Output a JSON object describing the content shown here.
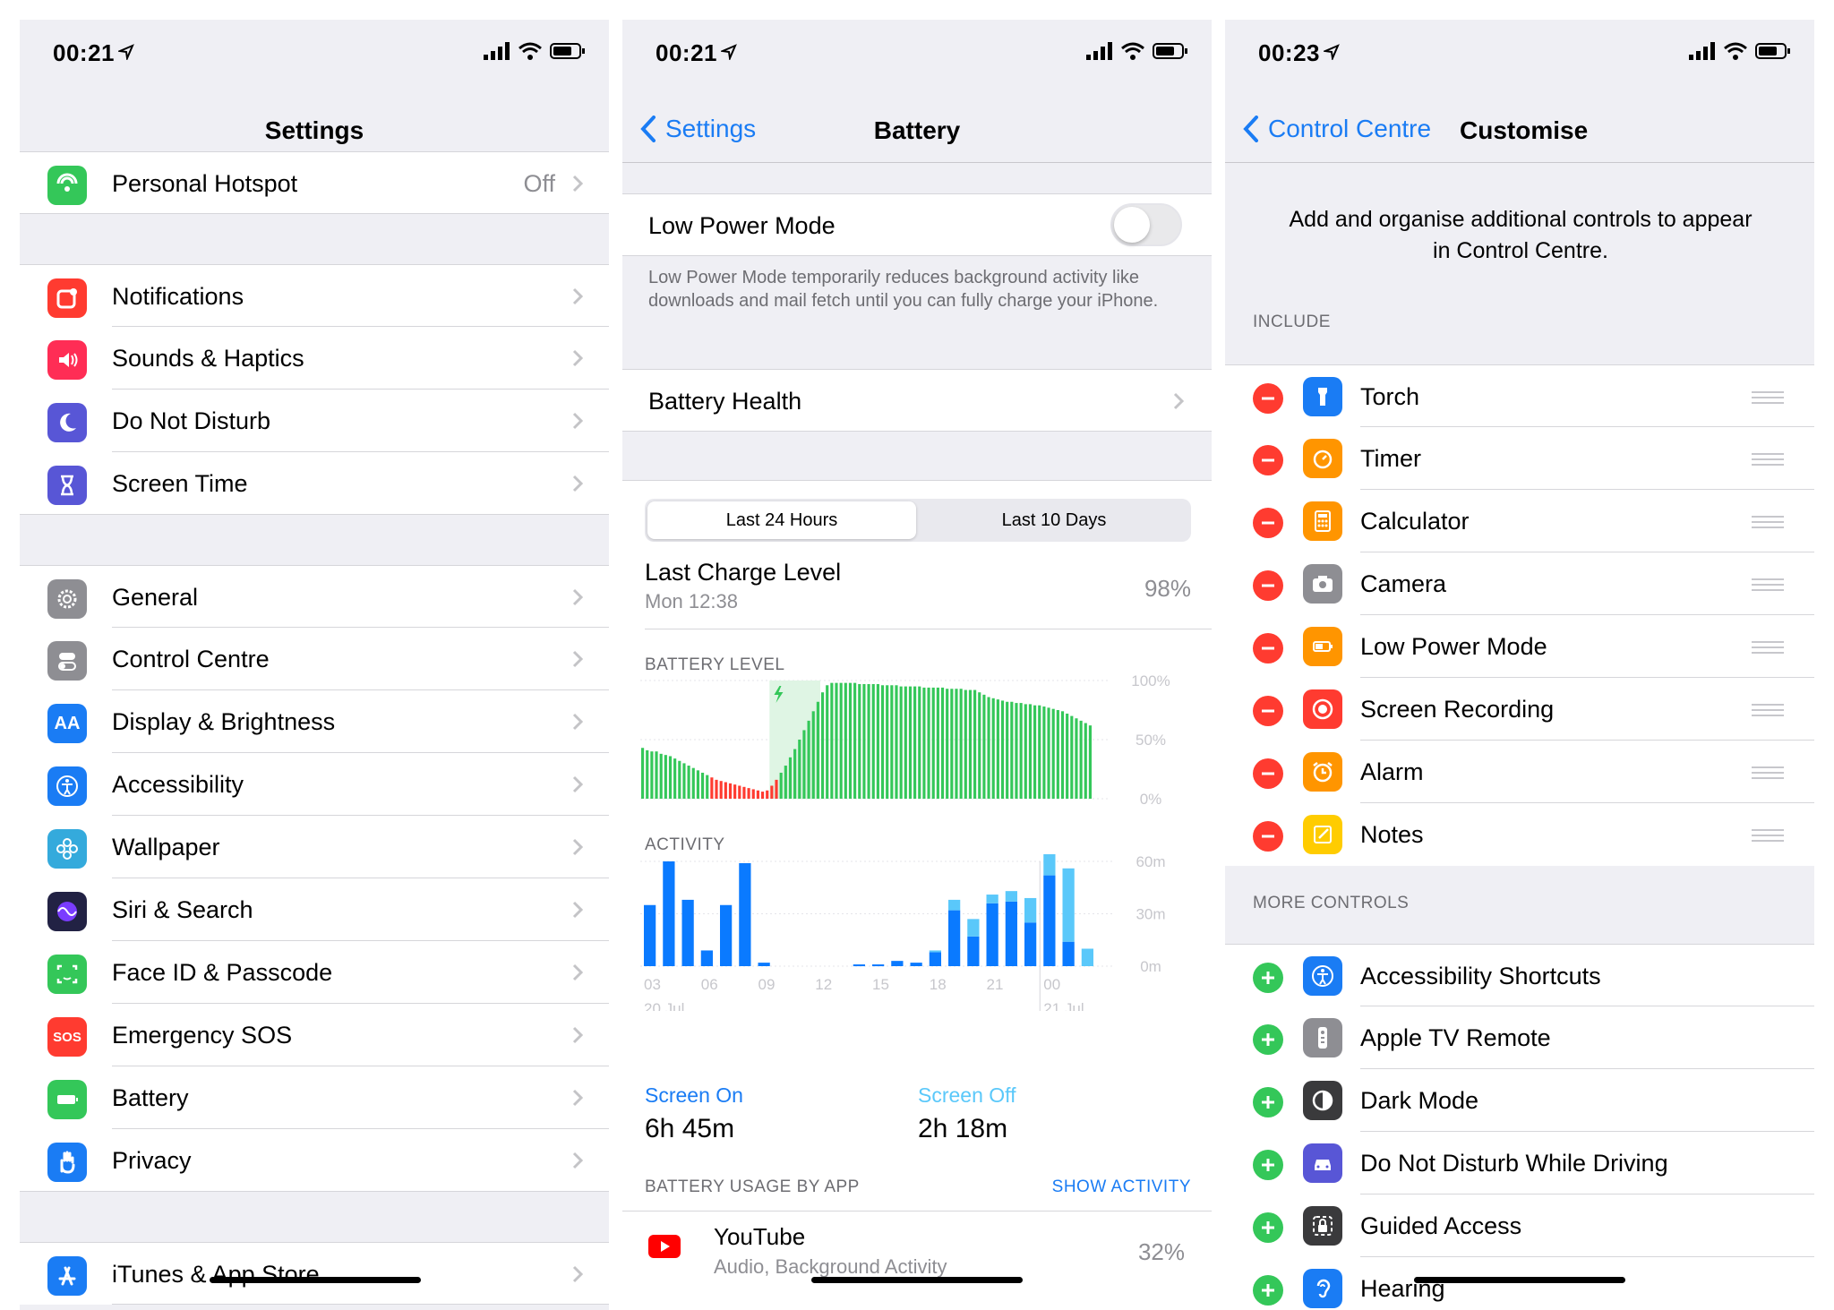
{
  "settings": {
    "status_time": "00:21",
    "title": "Settings",
    "rows": [
      {
        "label": "Personal Hotspot",
        "value": "Off",
        "icon": "hotspot-icon",
        "color": "#34c759"
      },
      {
        "label": "Notifications",
        "icon": "notifications-icon",
        "color": "#ff3b30"
      },
      {
        "label": "Sounds & Haptics",
        "icon": "speaker-icon",
        "color": "#ff2d55"
      },
      {
        "label": "Do Not Disturb",
        "icon": "moon-icon",
        "color": "#5856d6"
      },
      {
        "label": "Screen Time",
        "icon": "hourglass-icon",
        "color": "#5856d6"
      },
      {
        "label": "General",
        "icon": "gear-icon",
        "color": "#8e8e93"
      },
      {
        "label": "Control Centre",
        "icon": "toggles-icon",
        "color": "#8e8e93"
      },
      {
        "label": "Display & Brightness",
        "icon": "aa-icon",
        "icon_text": "AA",
        "color": "#1a7cf4"
      },
      {
        "label": "Accessibility",
        "icon": "accessibility-icon",
        "color": "#1a7cf4"
      },
      {
        "label": "Wallpaper",
        "icon": "flower-icon",
        "color": "#34aadc"
      },
      {
        "label": "Siri & Search",
        "icon": "siri-icon",
        "color": "#222244"
      },
      {
        "label": "Face ID & Passcode",
        "icon": "face-id-icon",
        "color": "#34c759"
      },
      {
        "label": "Emergency SOS",
        "icon": "sos-icon",
        "icon_text": "SOS",
        "color": "#ff3b30"
      },
      {
        "label": "Battery",
        "icon": "battery-icon",
        "color": "#34c759"
      },
      {
        "label": "Privacy",
        "icon": "hand-icon",
        "color": "#1a7cf4"
      },
      {
        "label": "iTunes & App Store",
        "icon": "app-store-icon",
        "color": "#1a7cf4"
      }
    ]
  },
  "battery": {
    "status_time": "00:21",
    "back_label": "Settings",
    "title": "Battery",
    "low_power_label": "Low Power Mode",
    "low_power_on": false,
    "low_power_desc": "Low Power Mode temporarily reduces background activity like downloads and mail fetch until you can fully charge your iPhone.",
    "health_label": "Battery Health",
    "tabs": [
      "Last 24 Hours",
      "Last 10 Days"
    ],
    "selected_tab": 0,
    "last_charge_label": "Last Charge Level",
    "last_charge_time": "Mon 12:38",
    "last_charge_value": "98%",
    "battery_level_header": "BATTERY LEVEL",
    "activity_header": "ACTIVITY",
    "screen_on_label": "Screen On",
    "screen_on_value": "6h 45m",
    "screen_off_label": "Screen Off",
    "screen_off_value": "2h 18m",
    "usage_header": "BATTERY USAGE BY APP",
    "show_activity": "SHOW ACTIVITY",
    "app_name": "YouTube",
    "app_detail": "Audio, Background Activity",
    "app_percent": "32%",
    "colors": {
      "charge_ok": "#34c759",
      "charge_low": "#ff3b30",
      "screen_on": "#0a7aff",
      "screen_off": "#5ac8fa"
    }
  },
  "chart_data": [
    {
      "type": "bar",
      "title": "BATTERY LEVEL",
      "ylim": [
        0,
        100
      ],
      "yticks": [
        "100%",
        "50%",
        "0%"
      ],
      "charging_segment": {
        "start_index": 28,
        "end_index": 39
      },
      "low_threshold": 20,
      "values": [
        43,
        41,
        40,
        40,
        38,
        37,
        36,
        34,
        32,
        30,
        28,
        26,
        24,
        22,
        20,
        18,
        16,
        15,
        14,
        13,
        12,
        11,
        10,
        9,
        8,
        7,
        6,
        7,
        11,
        16,
        22,
        28,
        35,
        42,
        50,
        58,
        66,
        74,
        82,
        90,
        96,
        98,
        98,
        98,
        98,
        98,
        98,
        97,
        97,
        97,
        97,
        97,
        96,
        96,
        96,
        96,
        95,
        95,
        95,
        95,
        95,
        94,
        94,
        94,
        94,
        94,
        93,
        93,
        93,
        93,
        92,
        92,
        92,
        90,
        88,
        86,
        85,
        84,
        83,
        82,
        82,
        81,
        81,
        80,
        80,
        79,
        79,
        78,
        77,
        76,
        75,
        74,
        72,
        70,
        68,
        66,
        64,
        62
      ]
    },
    {
      "type": "bar",
      "title": "ACTIVITY",
      "ylim": [
        0,
        60
      ],
      "yticks": [
        "60m",
        "30m",
        "0m"
      ],
      "x_tick_labels": [
        "03",
        "06",
        "09",
        "12",
        "15",
        "18",
        "21",
        "00"
      ],
      "x_date_labels": [
        "20 Jul",
        "21 Jul"
      ],
      "series": [
        {
          "name": "Screen On",
          "values": [
            35,
            60,
            38,
            9,
            35,
            59,
            2,
            0,
            0,
            0,
            0,
            1,
            1,
            3,
            2,
            8,
            32,
            17,
            36,
            37,
            25,
            52,
            14,
            0
          ]
        },
        {
          "name": "Screen Off",
          "values": [
            0,
            0,
            0,
            0,
            0,
            0,
            0,
            0,
            0,
            0,
            0,
            0,
            0,
            0,
            0,
            1,
            6,
            10,
            5,
            6,
            14,
            38,
            42,
            10
          ]
        }
      ]
    }
  ],
  "customise": {
    "status_time": "00:23",
    "back_label": "Control Centre",
    "title": "Customise",
    "description": "Add and organise additional controls to appear in Control Centre.",
    "include_header": "INCLUDE",
    "included": [
      {
        "label": "Torch",
        "icon": "torch-icon",
        "color": "#1a7cf4"
      },
      {
        "label": "Timer",
        "icon": "timer-icon",
        "color": "#ff9500"
      },
      {
        "label": "Calculator",
        "icon": "calculator-icon",
        "color": "#ff9500"
      },
      {
        "label": "Camera",
        "icon": "camera-icon",
        "color": "#8e8e93"
      },
      {
        "label": "Low Power Mode",
        "icon": "low-power-icon",
        "color": "#ff9500"
      },
      {
        "label": "Screen Recording",
        "icon": "record-icon",
        "color": "#ff3b30"
      },
      {
        "label": "Alarm",
        "icon": "alarm-icon",
        "color": "#ff9500"
      },
      {
        "label": "Notes",
        "icon": "notes-icon",
        "color": "#ffcc00"
      }
    ],
    "more_header": "MORE CONTROLS",
    "more": [
      {
        "label": "Accessibility Shortcuts",
        "icon": "accessibility-icon",
        "color": "#1a7cf4"
      },
      {
        "label": "Apple TV Remote",
        "icon": "remote-icon",
        "color": "#8e8e93"
      },
      {
        "label": "Dark Mode",
        "icon": "dark-mode-icon",
        "color": "#3a3a3c"
      },
      {
        "label": "Do Not Disturb While Driving",
        "icon": "car-icon",
        "color": "#5856d6"
      },
      {
        "label": "Guided Access",
        "icon": "lock-icon",
        "color": "#3a3a3c"
      },
      {
        "label": "Hearing",
        "icon": "ear-icon",
        "color": "#1a7cf4"
      }
    ]
  }
}
